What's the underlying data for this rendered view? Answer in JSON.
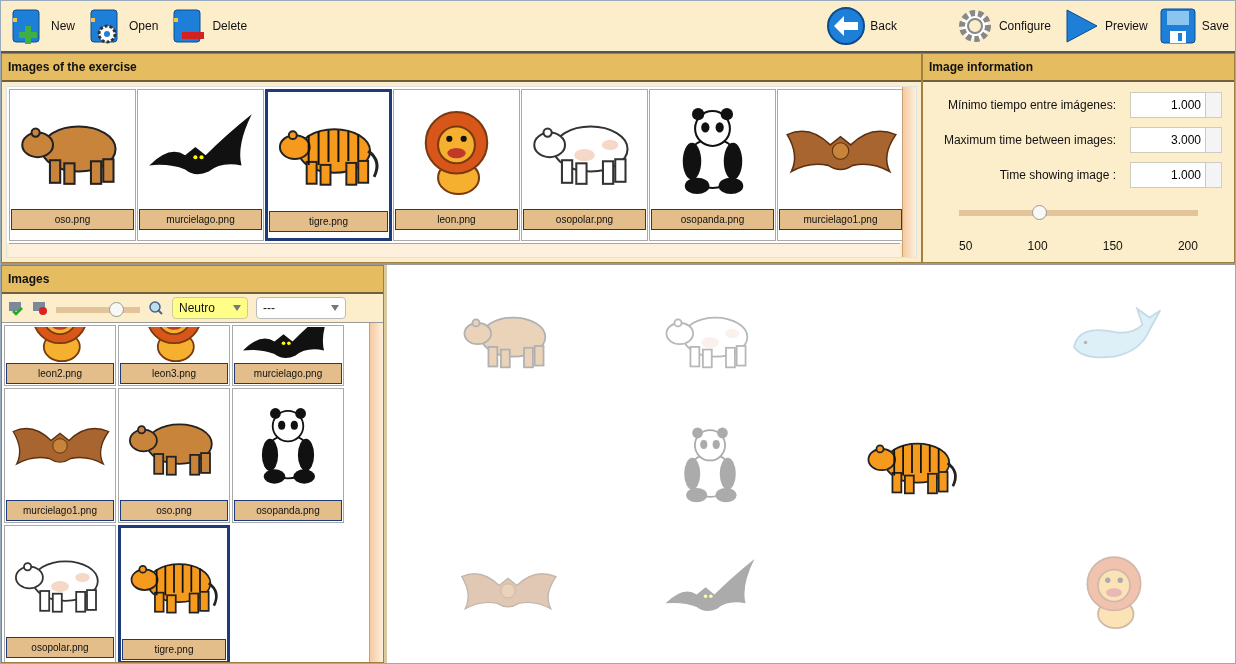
{
  "toolbar": {
    "left": [
      {
        "label": "New",
        "kind": "new"
      },
      {
        "label": "Open",
        "kind": "open"
      },
      {
        "label": "Delete",
        "kind": "delete"
      }
    ],
    "right": [
      {
        "label": "Back",
        "kind": "back"
      },
      {
        "label": "Configure",
        "kind": "configure"
      },
      {
        "label": "Preview",
        "kind": "preview"
      },
      {
        "label": "Save",
        "kind": "save"
      }
    ]
  },
  "exercise_panel": {
    "title": "Images of the exercise",
    "images": [
      {
        "file": "oso.png",
        "kind": "bear",
        "selected": false
      },
      {
        "file": "murcielago.png",
        "kind": "bat",
        "selected": false
      },
      {
        "file": "tigre.png",
        "kind": "tiger",
        "selected": true
      },
      {
        "file": "leon.png",
        "kind": "lion",
        "selected": false
      },
      {
        "file": "osopolar.png",
        "kind": "polarbear",
        "selected": false
      },
      {
        "file": "osopanda.png",
        "kind": "panda",
        "selected": false
      },
      {
        "file": "murcielago1.png",
        "kind": "brownbat",
        "selected": false
      }
    ]
  },
  "info_panel": {
    "title": "Image information",
    "fields": [
      {
        "label": "Mínimo tiempo entre imágenes:",
        "value": "1.000"
      },
      {
        "label": "Maximum time between images:",
        "value": "3.000"
      },
      {
        "label": "Time showing image :",
        "value": "1.000"
      }
    ],
    "slider": {
      "level": 0.333,
      "ticks": [
        "50",
        "100",
        "150",
        "200"
      ]
    }
  },
  "images_panel": {
    "title": "Images",
    "zoom": {
      "level": 0.72
    },
    "category": "Neutro",
    "filter": "---",
    "images": [
      {
        "file": "leon2.png",
        "kind": "lion",
        "selected": false
      },
      {
        "file": "leon3.png",
        "kind": "lion",
        "selected": false
      },
      {
        "file": "murcielago.png",
        "kind": "bat",
        "selected": false
      },
      {
        "file": "murcielago1.png",
        "kind": "brownbat",
        "selected": false
      },
      {
        "file": "oso.png",
        "kind": "bear",
        "selected": false
      },
      {
        "file": "osopanda.png",
        "kind": "panda",
        "selected": false
      },
      {
        "file": "osopolar.png",
        "kind": "polarbear",
        "selected": false
      },
      {
        "file": "tigre.png",
        "kind": "tiger",
        "selected": true
      }
    ]
  },
  "canvas": {
    "items": [
      {
        "kind": "bear",
        "faded": true
      },
      {
        "kind": "polarbear",
        "faded": true
      },
      {
        "kind": "whale",
        "faded": true
      },
      {
        "kind": "panda",
        "faded": true
      },
      {
        "kind": "tiger",
        "faded": false
      },
      {
        "kind": "brownbat",
        "faded": true
      },
      {
        "kind": "bat",
        "faded": true
      },
      {
        "kind": "lion",
        "faded": true
      }
    ]
  }
}
